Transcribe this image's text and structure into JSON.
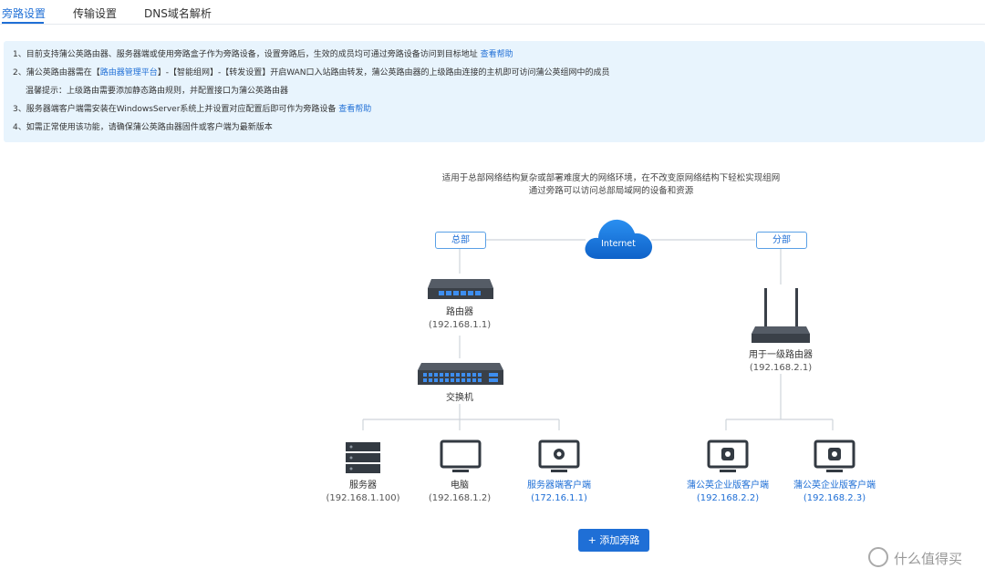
{
  "tabs": [
    {
      "label": "旁路设置"
    },
    {
      "label": "传输设置"
    },
    {
      "label": "DNS域名解析"
    }
  ],
  "notice": {
    "line1": "1、目前支持蒲公英路由器、服务器端或使用旁路盒子作为旁路设备，设置旁路后，生效的成员均可通过旁路设备访问到目标地址",
    "line1_link": "查看帮助",
    "line2_a": "2、蒲公英路由器需在【",
    "line2_link": "路由器管理平台",
    "line2_b": "】-【智能组网】-【转发设置】开启WAN口入站路由转发，蒲公英路由器的上级路由连接的主机即可访问蒲公英组网中的成员",
    "line2_sub": "温馨提示：上级路由需要添加静态路由规则，并配置接口为蒲公英路由器",
    "line3": "3、服务器端客户端需安装在WindowsServer系统上并设置对应配置后即可作为旁路设备",
    "line3_link": "查看帮助",
    "line4": "4、如需正常使用该功能，请确保蒲公英路由器固件或客户端为最新版本"
  },
  "diagram": {
    "desc1": "适用于总部网络结构复杂或部署难度大的网络环境，在不改变原网络结构下轻松实现组网",
    "desc2": "通过旁路可以访问总部局域网的设备和资源",
    "hq_label": "总部",
    "branch_label": "分部",
    "cloud_label": "Internet",
    "router": {
      "name": "路由器",
      "ip": "(192.168.1.1)"
    },
    "switch": {
      "name": "交换机"
    },
    "branch_router": {
      "name": "用于一级路由器",
      "ip": "(192.168.2.1)"
    },
    "server": {
      "name": "服务器",
      "ip": "(192.168.1.100)"
    },
    "pc": {
      "name": "电脑",
      "ip": "(192.168.1.2)"
    },
    "server_client": {
      "name": "服务器端客户端",
      "ip": "(172.16.1.1)"
    },
    "ent_client1": {
      "name": "蒲公英企业版客户端",
      "ip": "(192.168.2.2)"
    },
    "ent_client2": {
      "name": "蒲公英企业版客户端",
      "ip": "(192.168.2.3)"
    }
  },
  "actions": {
    "add_label": "+ 添加旁路"
  },
  "watermark": "什么值得买",
  "colors": {
    "accent": "#1f6fd6",
    "notice_bg": "#e8f4fd",
    "line": "#cfd4da"
  }
}
